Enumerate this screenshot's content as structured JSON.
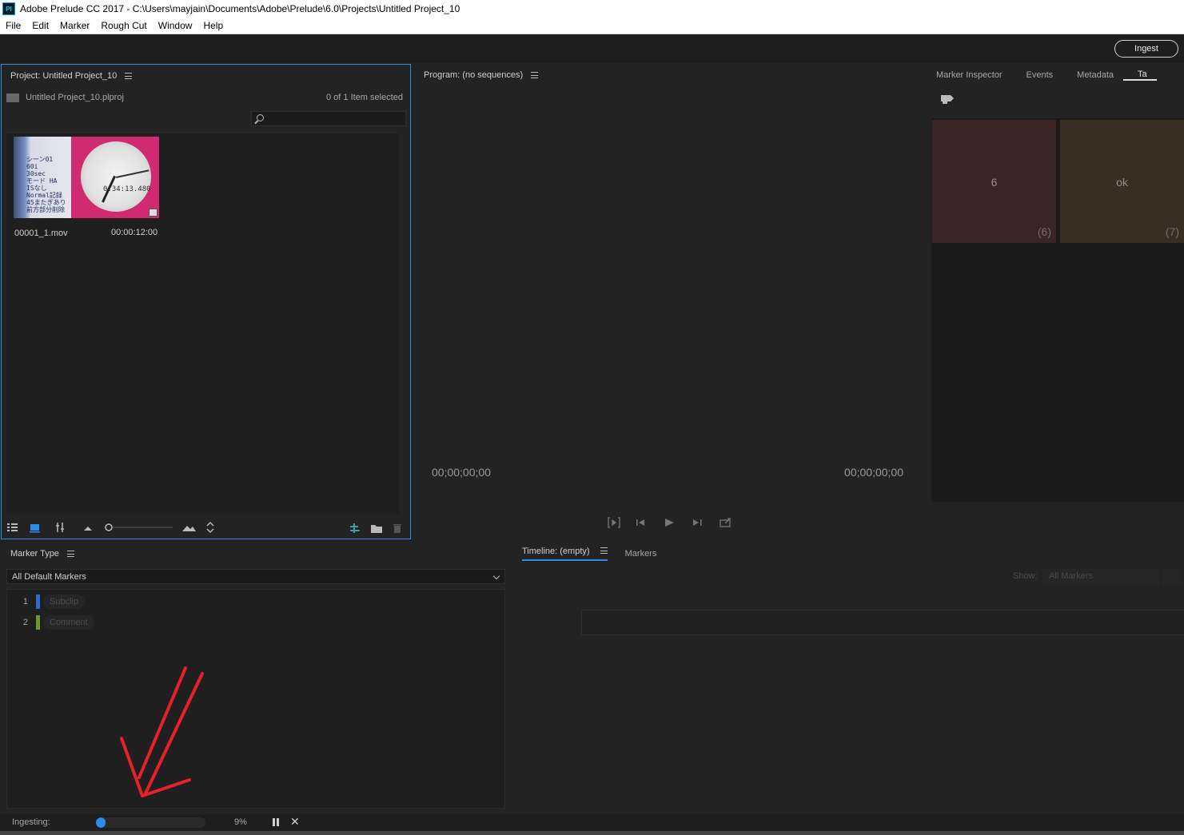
{
  "window": {
    "icon": "Pl",
    "title": "Adobe Prelude CC 2017 - C:\\Users\\mayjain\\Documents\\Adobe\\Prelude\\6.0\\Projects\\Untitled Project_10"
  },
  "menu": [
    "File",
    "Edit",
    "Marker",
    "Rough Cut",
    "Window",
    "Help"
  ],
  "appbar": {
    "ingest_label": "Ingest"
  },
  "project": {
    "title": "Project: Untitled Project_10",
    "file": "Untitled Project_10.plproj",
    "selection": "0 of 1 Item selected",
    "clip": {
      "name": "00001_1.mov",
      "duration": "00:00:12:00",
      "thumb_text": [
        "シーン01",
        "60i",
        "30sec",
        "モード HA",
        "ISなし",
        "Normal記録",
        "45またぎあり",
        "前方部分削除"
      ],
      "clock_text": "0:34:13.480"
    }
  },
  "program": {
    "title": "Program: (no sequences)",
    "tc_left": "00;00;00;00",
    "tc_right": "00;00;00;00"
  },
  "right_panel": {
    "tabs": [
      "Marker Inspector",
      "Events",
      "Metadata",
      "Ta"
    ],
    "tags": [
      {
        "name": "6",
        "count": "(6)",
        "color": "#3a2424"
      },
      {
        "name": "ok",
        "count": "(7)",
        "color": "#3a2e22"
      }
    ]
  },
  "marker_type": {
    "title": "Marker Type",
    "dropdown": "All Default Markers",
    "items": [
      {
        "num": "1",
        "label": "Subclip",
        "color": "#2d6cc8"
      },
      {
        "num": "2",
        "label": "Comment",
        "color": "#6a9a2a"
      }
    ]
  },
  "timeline": {
    "tabs": [
      "Timeline: (empty)",
      "Markers"
    ],
    "show_label": "Show:",
    "show_value": "All Markers"
  },
  "status": {
    "label": "Ingesting:",
    "progress": 0.09,
    "percent": "9%"
  },
  "colors": {
    "accent": "#2d8ceb",
    "annotation_arrow": "#e8202a"
  }
}
